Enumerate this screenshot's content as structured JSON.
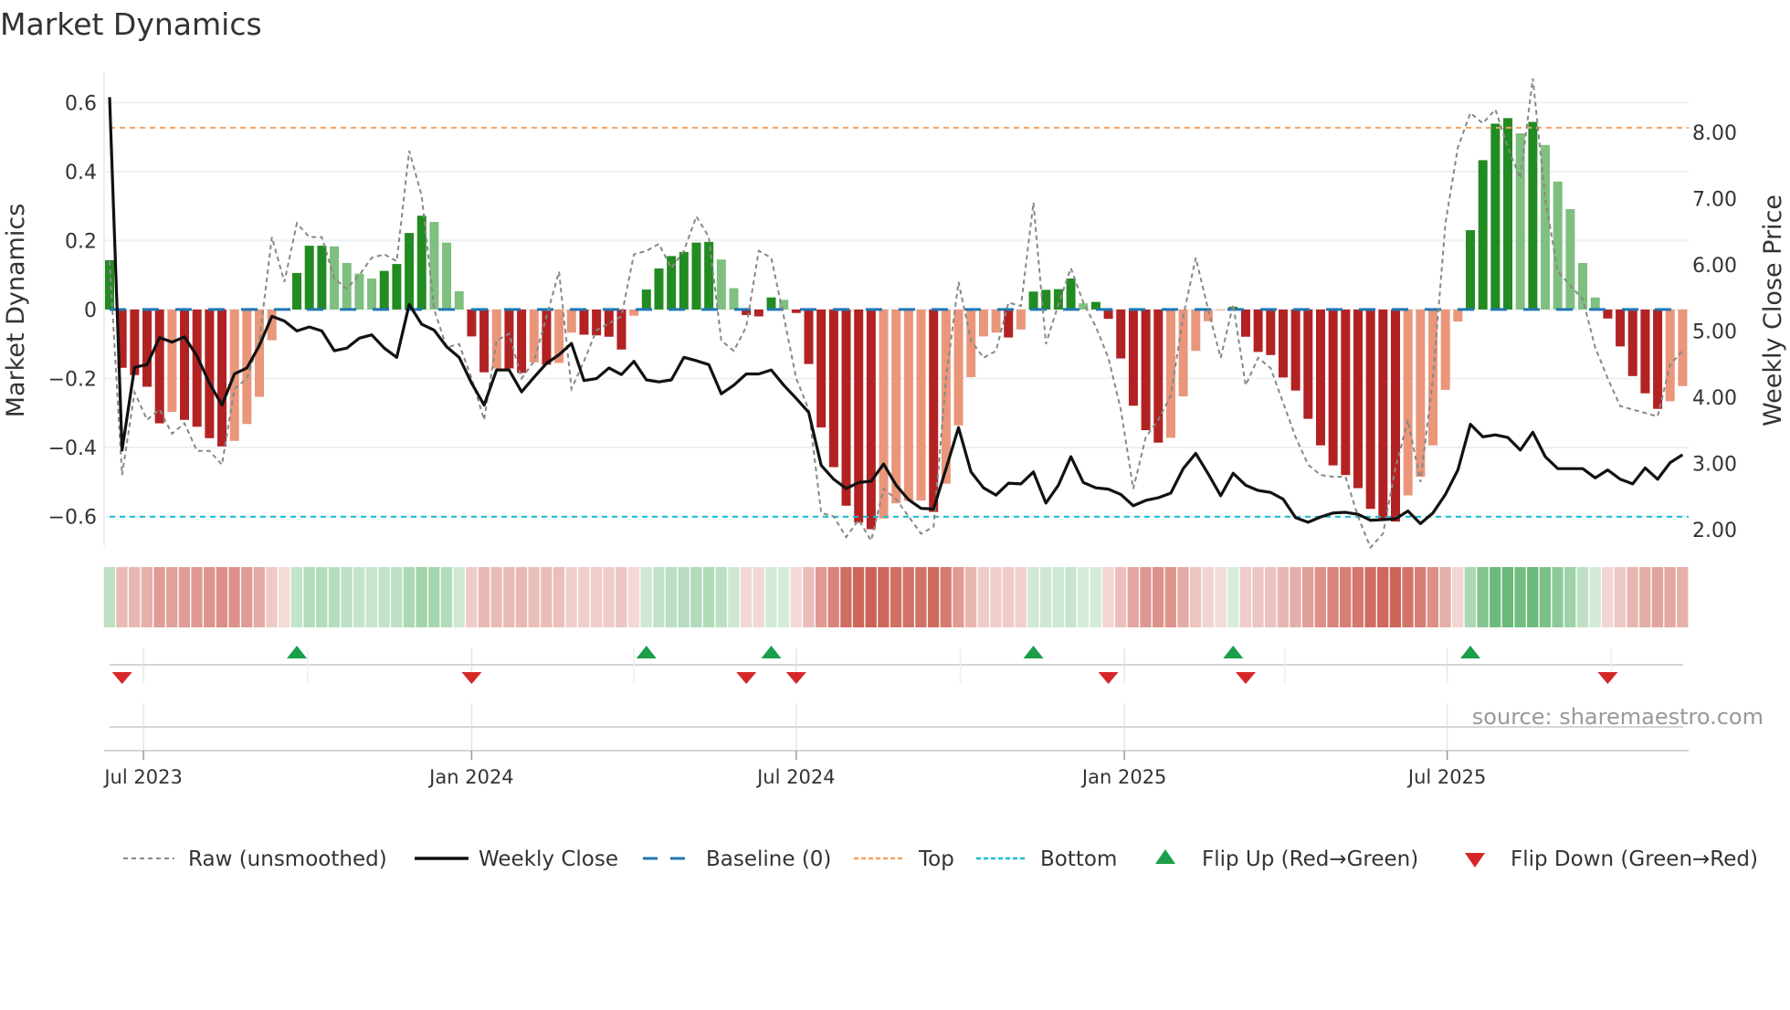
{
  "title": "Market Dynamics",
  "source": "source: sharemaestro.com",
  "colors": {
    "bar_dark_red": "#b22222",
    "bar_light_red": "#e9967a",
    "bar_dark_green": "#228b22",
    "bar_light_green": "#7fbf7f",
    "heat_red": "#c0392b",
    "heat_green": "#2e9e44",
    "weekly_close": "#111111",
    "raw": "#888888",
    "baseline": "#1f77b4",
    "top": "#f4a261",
    "bottom": "#17becf",
    "flip_up": "#1a9e48",
    "flip_down": "#d62728"
  },
  "chart_data": {
    "type": "bar",
    "title": "Market Dynamics",
    "ylabel": "Market Dynamics",
    "y2label": "Weekly Close Price",
    "ylim": [
      -0.686,
      0.683
    ],
    "y2lim": [
      1.75,
      8.88
    ],
    "yticks": [
      {
        "value": 0.6,
        "label": "0.6"
      },
      {
        "value": 0.4,
        "label": "0.4"
      },
      {
        "value": 0.2,
        "label": "0.2"
      },
      {
        "value": 0,
        "label": "0"
      },
      {
        "value": -0.2,
        "label": "−0.2"
      },
      {
        "value": -0.4,
        "label": "−0.4"
      },
      {
        "value": -0.6,
        "label": "−0.6"
      }
    ],
    "y2ticks": [
      {
        "value": 8,
        "label": "8.00"
      },
      {
        "value": 7,
        "label": "7.00"
      },
      {
        "value": 6,
        "label": "6.00"
      },
      {
        "value": 5,
        "label": "5.00"
      },
      {
        "value": 4,
        "label": "4.00"
      },
      {
        "value": 3,
        "label": "3.00"
      },
      {
        "value": 2,
        "label": "2.00"
      }
    ],
    "first_week": "2023-06-12",
    "xticks": [
      {
        "date": "2023-07-01",
        "label": "Jul 2023"
      },
      {
        "date": "2024-01-01",
        "label": "Jan 2024"
      },
      {
        "date": "2024-07-01",
        "label": "Jul 2024"
      },
      {
        "date": "2025-01-01",
        "label": "Jan 2025"
      },
      {
        "date": "2025-07-01",
        "label": "Jul 2025"
      }
    ],
    "minor_grid_dates": [
      "2023-10-01",
      "2024-04-01",
      "2024-10-01",
      "2025-04-01",
      "2025-10-01"
    ],
    "top_level": 0.527,
    "bottom_level": -0.601,
    "baseline": 0,
    "dynamics": [
      0.143,
      -0.169,
      -0.19,
      -0.224,
      -0.33,
      -0.297,
      -0.32,
      -0.34,
      -0.373,
      -0.397,
      -0.381,
      -0.332,
      -0.253,
      -0.089,
      -0.003,
      0.106,
      0.185,
      0.185,
      0.183,
      0.135,
      0.104,
      0.09,
      0.112,
      0.132,
      0.222,
      0.272,
      0.254,
      0.194,
      0.053,
      -0.078,
      -0.182,
      -0.171,
      -0.171,
      -0.184,
      -0.153,
      -0.16,
      -0.155,
      -0.067,
      -0.073,
      -0.075,
      -0.079,
      -0.116,
      -0.018,
      0.058,
      0.119,
      0.155,
      0.167,
      0.194,
      0.196,
      0.145,
      0.062,
      -0.016,
      -0.02,
      0.035,
      0.028,
      -0.01,
      -0.158,
      -0.342,
      -0.457,
      -0.569,
      -0.618,
      -0.637,
      -0.606,
      -0.562,
      -0.555,
      -0.554,
      -0.587,
      -0.505,
      -0.336,
      -0.196,
      -0.078,
      -0.067,
      -0.081,
      -0.058,
      0.052,
      0.057,
      0.059,
      0.09,
      0.018,
      0.022,
      -0.027,
      -0.142,
      -0.279,
      -0.35,
      -0.386,
      -0.372,
      -0.252,
      -0.12,
      -0.034,
      -0.002,
      0.008,
      -0.079,
      -0.123,
      -0.132,
      -0.197,
      -0.235,
      -0.317,
      -0.394,
      -0.452,
      -0.48,
      -0.518,
      -0.578,
      -0.606,
      -0.615,
      -0.539,
      -0.485,
      -0.394,
      -0.233,
      -0.035,
      0.23,
      0.433,
      0.539,
      0.555,
      0.511,
      0.544,
      0.477,
      0.371,
      0.291,
      0.135,
      0.035,
      -0.026,
      -0.107,
      -0.193,
      -0.243,
      -0.288,
      -0.266,
      -0.222
    ],
    "raw": [
      0.14,
      -0.48,
      -0.24,
      -0.32,
      -0.29,
      -0.36,
      -0.33,
      -0.41,
      -0.41,
      -0.45,
      -0.23,
      -0.2,
      -0.09,
      0.21,
      0.08,
      0.25,
      0.21,
      0.21,
      0.09,
      0.06,
      0.1,
      0.15,
      0.16,
      0.14,
      0.46,
      0.33,
      0.0,
      -0.11,
      -0.1,
      -0.2,
      -0.32,
      -0.09,
      -0.07,
      -0.2,
      -0.15,
      -0.02,
      0.11,
      -0.23,
      -0.15,
      -0.06,
      -0.04,
      -0.02,
      0.16,
      0.17,
      0.19,
      0.12,
      0.17,
      0.27,
      0.21,
      -0.09,
      -0.12,
      -0.05,
      0.17,
      0.15,
      -0.02,
      -0.2,
      -0.29,
      -0.59,
      -0.6,
      -0.66,
      -0.61,
      -0.67,
      -0.52,
      -0.55,
      -0.6,
      -0.65,
      -0.63,
      -0.2,
      0.08,
      -0.09,
      -0.14,
      -0.12,
      0.02,
      0.01,
      0.31,
      -0.1,
      0.015,
      0.12,
      0.02,
      -0.05,
      -0.14,
      -0.29,
      -0.52,
      -0.37,
      -0.32,
      -0.25,
      -0.02,
      0.15,
      0.0,
      -0.14,
      0.015,
      -0.22,
      -0.14,
      -0.17,
      -0.27,
      -0.37,
      -0.45,
      -0.48,
      -0.485,
      -0.485,
      -0.6,
      -0.69,
      -0.65,
      -0.46,
      -0.32,
      -0.5,
      -0.2,
      0.25,
      0.47,
      0.57,
      0.54,
      0.58,
      0.47,
      0.38,
      0.67,
      0.32,
      0.11,
      0.07,
      0.03,
      -0.11,
      -0.2,
      -0.28,
      -0.29,
      -0.3,
      -0.31,
      -0.16,
      -0.12
    ],
    "weekly_close": [
      8.53,
      3.2,
      4.45,
      4.49,
      4.9,
      4.83,
      4.91,
      4.62,
      4.21,
      3.88,
      4.35,
      4.44,
      4.78,
      5.22,
      5.15,
      5.0,
      5.06,
      5.0,
      4.7,
      4.74,
      4.89,
      4.94,
      4.74,
      4.6,
      5.4,
      5.1,
      5.01,
      4.76,
      4.6,
      4.21,
      3.88,
      4.41,
      4.41,
      4.08,
      4.3,
      4.51,
      4.64,
      4.81,
      4.25,
      4.28,
      4.44,
      4.34,
      4.54,
      4.26,
      4.23,
      4.26,
      4.6,
      4.55,
      4.49,
      4.05,
      4.18,
      4.35,
      4.35,
      4.41,
      4.18,
      3.98,
      3.77,
      2.97,
      2.76,
      2.62,
      2.71,
      2.73,
      2.99,
      2.67,
      2.45,
      2.32,
      2.31,
      2.92,
      3.54,
      2.87,
      2.63,
      2.52,
      2.7,
      2.69,
      2.87,
      2.4,
      2.67,
      3.1,
      2.71,
      2.63,
      2.61,
      2.53,
      2.36,
      2.44,
      2.48,
      2.55,
      2.92,
      3.15,
      2.84,
      2.51,
      2.85,
      2.67,
      2.59,
      2.56,
      2.46,
      2.18,
      2.11,
      2.19,
      2.25,
      2.26,
      2.23,
      2.14,
      2.15,
      2.16,
      2.28,
      2.09,
      2.25,
      2.53,
      2.9,
      3.59,
      3.4,
      3.43,
      3.39,
      3.2,
      3.47,
      3.1,
      2.92,
      2.92,
      2.92,
      2.78,
      2.9,
      2.76,
      2.69,
      2.93,
      2.76,
      3.01,
      3.13
    ],
    "flips_up": [
      15,
      43,
      53,
      74,
      90,
      109
    ],
    "flips_down": [
      1,
      29,
      51,
      55,
      80,
      91,
      120
    ],
    "legend": {
      "raw": "Raw (unsmoothed)",
      "weekly_close": "Weekly Close",
      "baseline": "Baseline (0)",
      "top": "Top",
      "bottom": "Bottom",
      "flip_up": "Flip Up (Red→Green)",
      "flip_down": "Flip Down (Green→Red)"
    }
  }
}
